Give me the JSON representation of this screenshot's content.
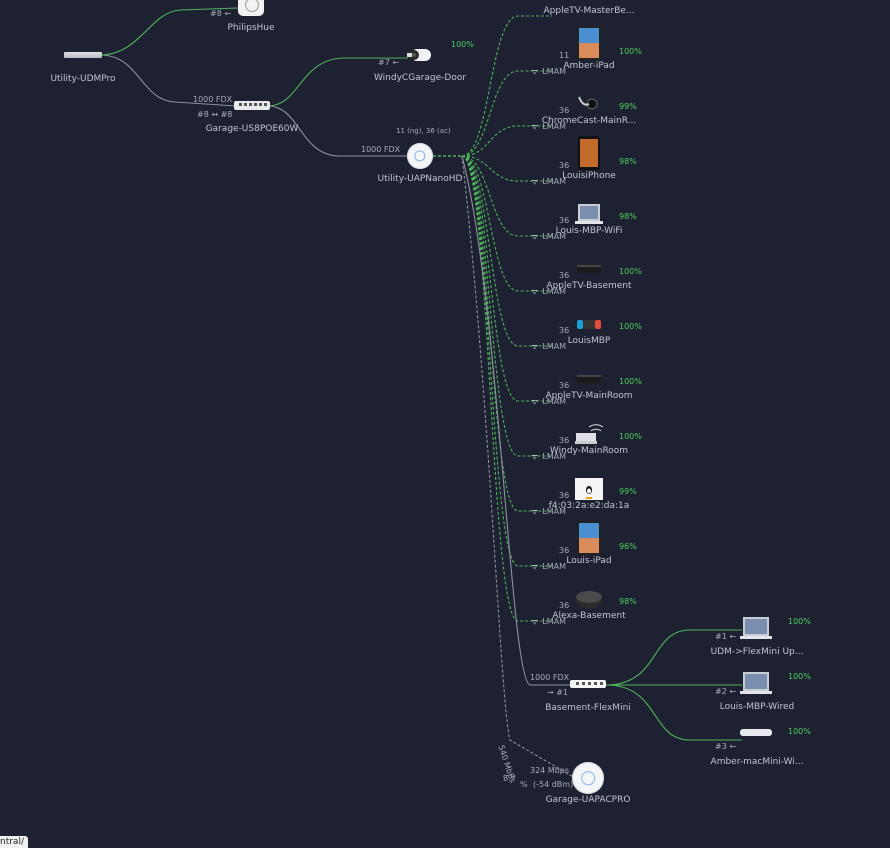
{
  "colors": {
    "background": "#1d2131",
    "wired_link": "#8e929c",
    "wifi_link": "#4fb35a",
    "status_good": "#4fcf5e",
    "label": "#c3c6d0"
  },
  "uplink": {
    "udm": "Utility-UDMPro"
  },
  "hue": {
    "name": "PhilipsHue",
    "port": "#8 ←",
    "icon": "bridge-icon"
  },
  "switch": {
    "name": "Garage-US8POE60W",
    "speed": "1000 FDX",
    "ports": "#8 ↔ #8",
    "icon": "switch-icon"
  },
  "camera": {
    "name": "WindyCGarage-Door",
    "port": "#7 ←",
    "pct": "100%",
    "icon": "camera-icon"
  },
  "ap": {
    "name": "Utility-UAPNanoHD",
    "speed": "1000 FDX",
    "channels": "11 (ng), 36 (ac)",
    "icon": "access-point-icon"
  },
  "clients": [
    {
      "name": "AppleTV-MasterBe...",
      "channel": "",
      "mode": "",
      "pct": "",
      "icon": "appletv-icon"
    },
    {
      "name": "Amber-iPad",
      "channel": "11",
      "mode": "LMAM",
      "pct": "100%",
      "icon": "ipad-icon"
    },
    {
      "name": "ChromeCast-MainR...",
      "channel": "36",
      "mode": "LMAM",
      "pct": "99%",
      "icon": "chromecast-icon"
    },
    {
      "name": "LouisiPhone",
      "channel": "36",
      "mode": "LMAM",
      "pct": "98%",
      "icon": "iphone-icon"
    },
    {
      "name": "Louis-MBP-WiFi",
      "channel": "36",
      "mode": "LMAM",
      "pct": "98%",
      "icon": "laptop-icon"
    },
    {
      "name": "AppleTV-Basement",
      "channel": "36",
      "mode": "LMAM",
      "pct": "100%",
      "icon": "appletv-icon"
    },
    {
      "name": "LouisMBP",
      "channel": "36",
      "mode": "LMAM",
      "pct": "100%",
      "icon": "switch-console-icon"
    },
    {
      "name": "AppleTV-MainRoom",
      "channel": "36",
      "mode": "LMAM",
      "pct": "100%",
      "icon": "appletv-icon"
    },
    {
      "name": "Windy-MainRoom",
      "channel": "36",
      "mode": "LMAM",
      "pct": "100%",
      "icon": "wifi-laptop-icon"
    },
    {
      "name": "f4:03:2a:e2:da:1a",
      "channel": "36",
      "mode": "LMAM",
      "pct": "99%",
      "icon": "linux-icon"
    },
    {
      "name": "Louis-iPad",
      "channel": "36",
      "mode": "LMAM",
      "pct": "96%",
      "icon": "ipad-icon"
    },
    {
      "name": "Alexa-Basement",
      "channel": "36",
      "mode": "LMAM",
      "pct": "98%",
      "icon": "echo-dot-icon"
    }
  ],
  "flexmini": {
    "name": "Basement-FlexMini",
    "speed": "1000 FDX",
    "port": "→ #1",
    "icon": "switch-icon"
  },
  "wired_clients": [
    {
      "name": "UDM->FlexMini Up...",
      "port": "#1 ←",
      "pct": "100%",
      "icon": "laptop-icon"
    },
    {
      "name": "Louis-MBP-Wired",
      "port": "#2 ←",
      "pct": "100%",
      "icon": "laptop-icon"
    },
    {
      "name": "Amber-macMini-Wi...",
      "port": "#3 ←",
      "pct": "100%",
      "icon": "mac-mini-icon"
    }
  ],
  "mesh_ap": {
    "name": "Garage-UAPACPRO",
    "uplink_rate": "540 Mbps",
    "rate": "324 Mbps",
    "signal": "(-54 dBm)",
    "pct_prefix": "% ",
    "pct_num": "8 9",
    "icon": "access-point-icon"
  },
  "browser": {
    "url_fragment": "ntral/"
  }
}
